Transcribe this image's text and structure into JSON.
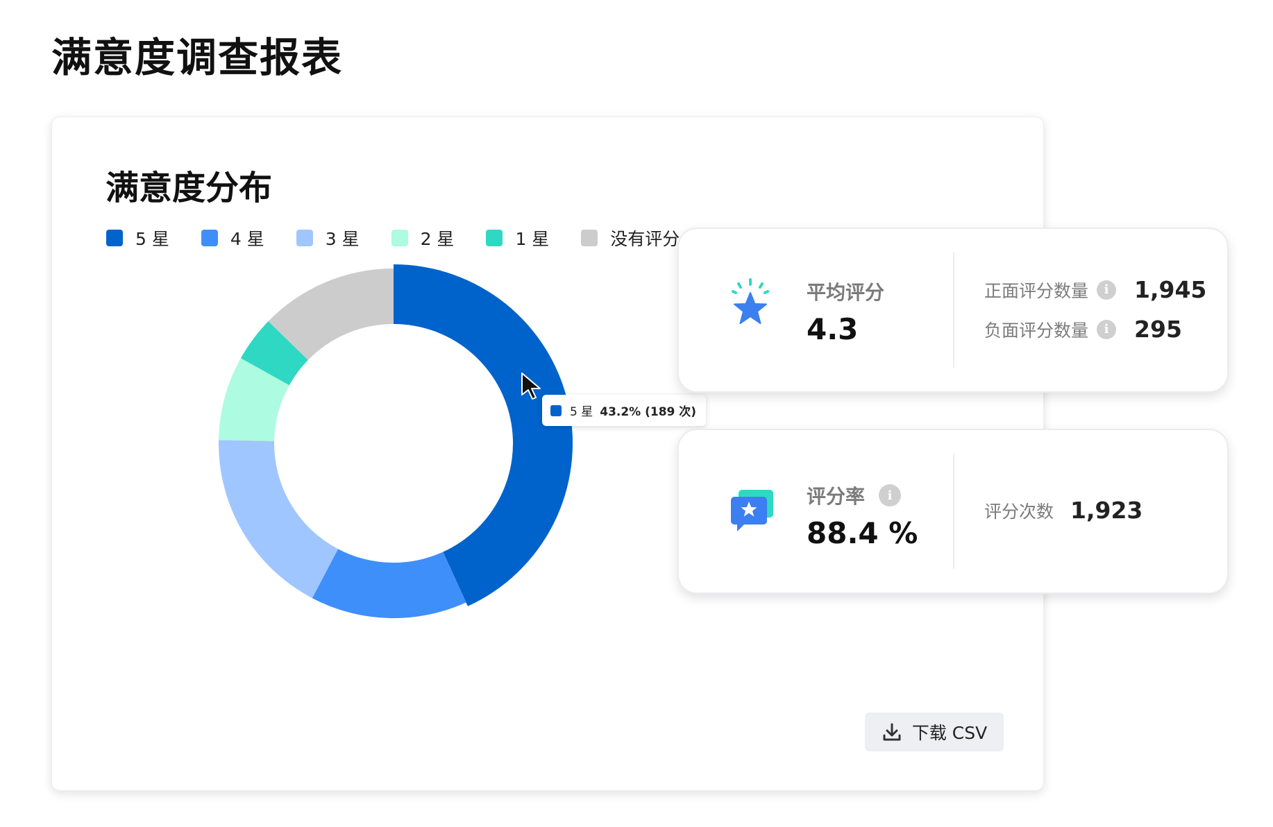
{
  "page": {
    "title": "满意度调查报表"
  },
  "distribution_card": {
    "title": "满意度分布",
    "legend": [
      {
        "label": "5 星",
        "color": "#0063cc"
      },
      {
        "label": "4 星",
        "color": "#3f8ffa"
      },
      {
        "label": "3 星",
        "color": "#a0c6ff"
      },
      {
        "label": "2 星",
        "color": "#adfbe0"
      },
      {
        "label": "1 星",
        "color": "#2ed8c3"
      },
      {
        "label": "没有评分",
        "color": "#cccccc"
      }
    ],
    "tooltip": {
      "name": "5 星",
      "value": "43.2% (189 次)",
      "color": "#0063cc"
    },
    "download_label": "下载 CSV"
  },
  "chart_data": {
    "type": "pie",
    "categories": [
      "5 星",
      "4 星",
      "3 星",
      "2 星",
      "1 星",
      "没有评分"
    ],
    "values": [
      43.2,
      14.5,
      17.6,
      7.8,
      4.2,
      12.7
    ],
    "unit": "%",
    "colors": [
      "#0063cc",
      "#3f8ffa",
      "#a0c6ff",
      "#adfbe0",
      "#2ed8c3",
      "#cccccc"
    ],
    "donut": true,
    "highlighted": "5 星"
  },
  "rating_card": {
    "icon": "star-icon",
    "label": "平均评分",
    "value": "4.3",
    "rows": [
      {
        "label": "正面评分数量",
        "value": "1,945"
      },
      {
        "label": "负面评分数量",
        "value": "295"
      }
    ]
  },
  "rate_card": {
    "icon": "chat-star-icon",
    "label": "评分率",
    "value": "88.4 %",
    "rows": [
      {
        "label": "评分次数",
        "value": "1,923"
      }
    ]
  },
  "info_glyph": "i"
}
